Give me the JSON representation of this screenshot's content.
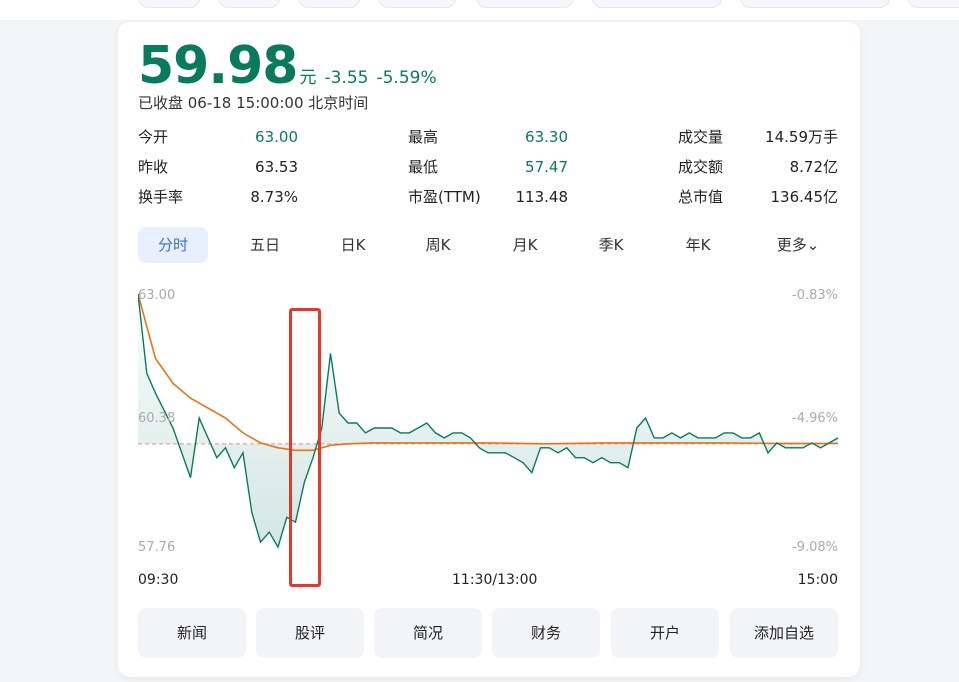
{
  "quote": {
    "price": "59.98",
    "currency": "元",
    "change": "-3.55",
    "change_pct": "-5.59%",
    "status": "已收盘 06-18 15:00:00 北京时间"
  },
  "stats": [
    {
      "label": "今开",
      "value": "63.00"
    },
    {
      "label": "最高",
      "value": "63.30"
    },
    {
      "label": "成交量",
      "value": "14.59万手"
    },
    {
      "label": "昨收",
      "value": "63.53"
    },
    {
      "label": "最低",
      "value": "57.47"
    },
    {
      "label": "成交额",
      "value": "8.72亿"
    },
    {
      "label": "换手率",
      "value": "8.73%"
    },
    {
      "label": "市盈(TTM)",
      "value": "113.48"
    },
    {
      "label": "总市值",
      "value": "136.45亿"
    }
  ],
  "tabs": [
    "分时",
    "五日",
    "日K",
    "周K",
    "月K",
    "季K",
    "年K",
    "更多"
  ],
  "active_tab": "分时",
  "chart": {
    "y_left_top": "63.00",
    "y_left_mid": "60.38",
    "y_left_bottom": "57.76",
    "y_right_top": "-0.83%",
    "y_right_mid": "-4.96%",
    "y_right_bottom": "-9.08%",
    "x_start": "09:30",
    "x_mid": "11:30/13:00",
    "x_end": "15:00",
    "colors": {
      "price_line": "#0a7a5f",
      "avg_line": "#e8731a",
      "prev_close": "#e88"
    }
  },
  "buttons": [
    "新闻",
    "股评",
    "简况",
    "财务",
    "开户",
    "添加自选"
  ],
  "chart_data": {
    "type": "line",
    "title": "",
    "xlabel": "",
    "ylabel": "",
    "x_ticks": [
      "09:30",
      "11:30/13:00",
      "15:00"
    ],
    "ylim": [
      57.76,
      63.0
    ],
    "prev_close": 63.53,
    "series": [
      {
        "x": [
          0,
          3,
          6,
          12,
          18,
          21,
          24,
          27,
          30,
          33,
          36,
          39,
          42,
          45,
          48,
          51,
          54,
          57,
          60,
          63,
          66,
          69,
          72,
          75,
          78,
          81,
          84,
          87,
          90,
          93,
          96,
          99,
          102,
          105,
          108,
          111,
          114,
          117,
          120,
          123,
          126,
          129,
          132,
          135,
          138,
          141,
          144,
          147,
          150,
          153,
          156,
          159,
          162,
          165,
          168,
          171,
          174,
          177,
          180,
          183,
          186,
          189,
          192,
          195,
          198,
          201,
          204,
          207,
          210,
          213,
          216,
          219,
          222,
          225,
          228,
          231,
          234,
          237,
          240
        ],
        "values": [
          63.0,
          61.4,
          61.0,
          60.3,
          59.3,
          60.5,
          60.1,
          59.7,
          59.9,
          59.5,
          59.8,
          58.6,
          58.0,
          58.2,
          57.9,
          58.5,
          58.4,
          59.2,
          59.7,
          60.3,
          61.8,
          60.6,
          60.4,
          60.4,
          60.2,
          60.3,
          60.3,
          60.3,
          60.2,
          60.2,
          60.3,
          60.4,
          60.2,
          60.1,
          60.2,
          60.2,
          60.1,
          59.9,
          59.8,
          59.8,
          59.8,
          59.7,
          59.6,
          59.4,
          59.9,
          59.9,
          59.8,
          59.9,
          59.7,
          59.7,
          59.6,
          59.7,
          59.6,
          59.6,
          59.5,
          60.3,
          60.5,
          60.1,
          60.1,
          60.2,
          60.1,
          60.2,
          60.1,
          60.1,
          60.1,
          60.2,
          60.2,
          60.1,
          60.1,
          60.2,
          59.8,
          60.0,
          59.9,
          59.9,
          59.9,
          60.0,
          59.9,
          60.0,
          60.1
        ]
      },
      {
        "x": [
          0,
          6,
          12,
          18,
          24,
          30,
          36,
          42,
          48,
          54,
          60,
          66,
          72,
          80,
          100,
          120,
          140,
          160,
          180,
          200,
          220,
          240
        ],
        "values": [
          63.0,
          61.7,
          61.2,
          60.9,
          60.7,
          60.5,
          60.2,
          60.0,
          59.9,
          59.85,
          59.85,
          59.95,
          59.98,
          60.0,
          60.0,
          60.0,
          59.98,
          60.0,
          60.0,
          60.0,
          59.99,
          59.99
        ]
      }
    ]
  }
}
